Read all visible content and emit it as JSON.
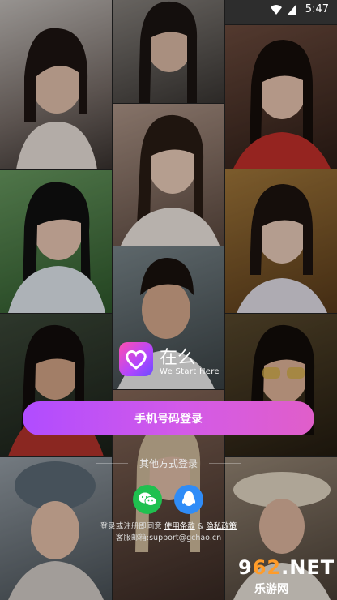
{
  "status_bar": {
    "time": "5:47"
  },
  "logo": {
    "app_name": "在么",
    "tagline": "We Start Here"
  },
  "login": {
    "phone_button_label": "手机号码登录",
    "other_methods_label": "其他方式登录"
  },
  "social": [
    {
      "name": "wechat-icon",
      "color": "#1fc04f"
    },
    {
      "name": "qq-icon",
      "color": "#2f8cf7"
    }
  ],
  "terms": {
    "prefix": "登录或注册即同意",
    "terms_link": "使用条款",
    "amp": " & ",
    "privacy_link": "隐私政策"
  },
  "support": {
    "text": "客服邮箱:support@gchao.cn"
  },
  "watermark": {
    "top_prefix": "9",
    "top_accent": "62",
    "top_suffix": ".NET",
    "bottom": "乐游网"
  },
  "colors": {
    "button_gradient_start": "#b04cff",
    "button_gradient_end": "#e05ec9",
    "wechat_green": "#1fc04f",
    "qq_blue": "#2f8cf7",
    "logo_pink": "#ff4fb0"
  }
}
